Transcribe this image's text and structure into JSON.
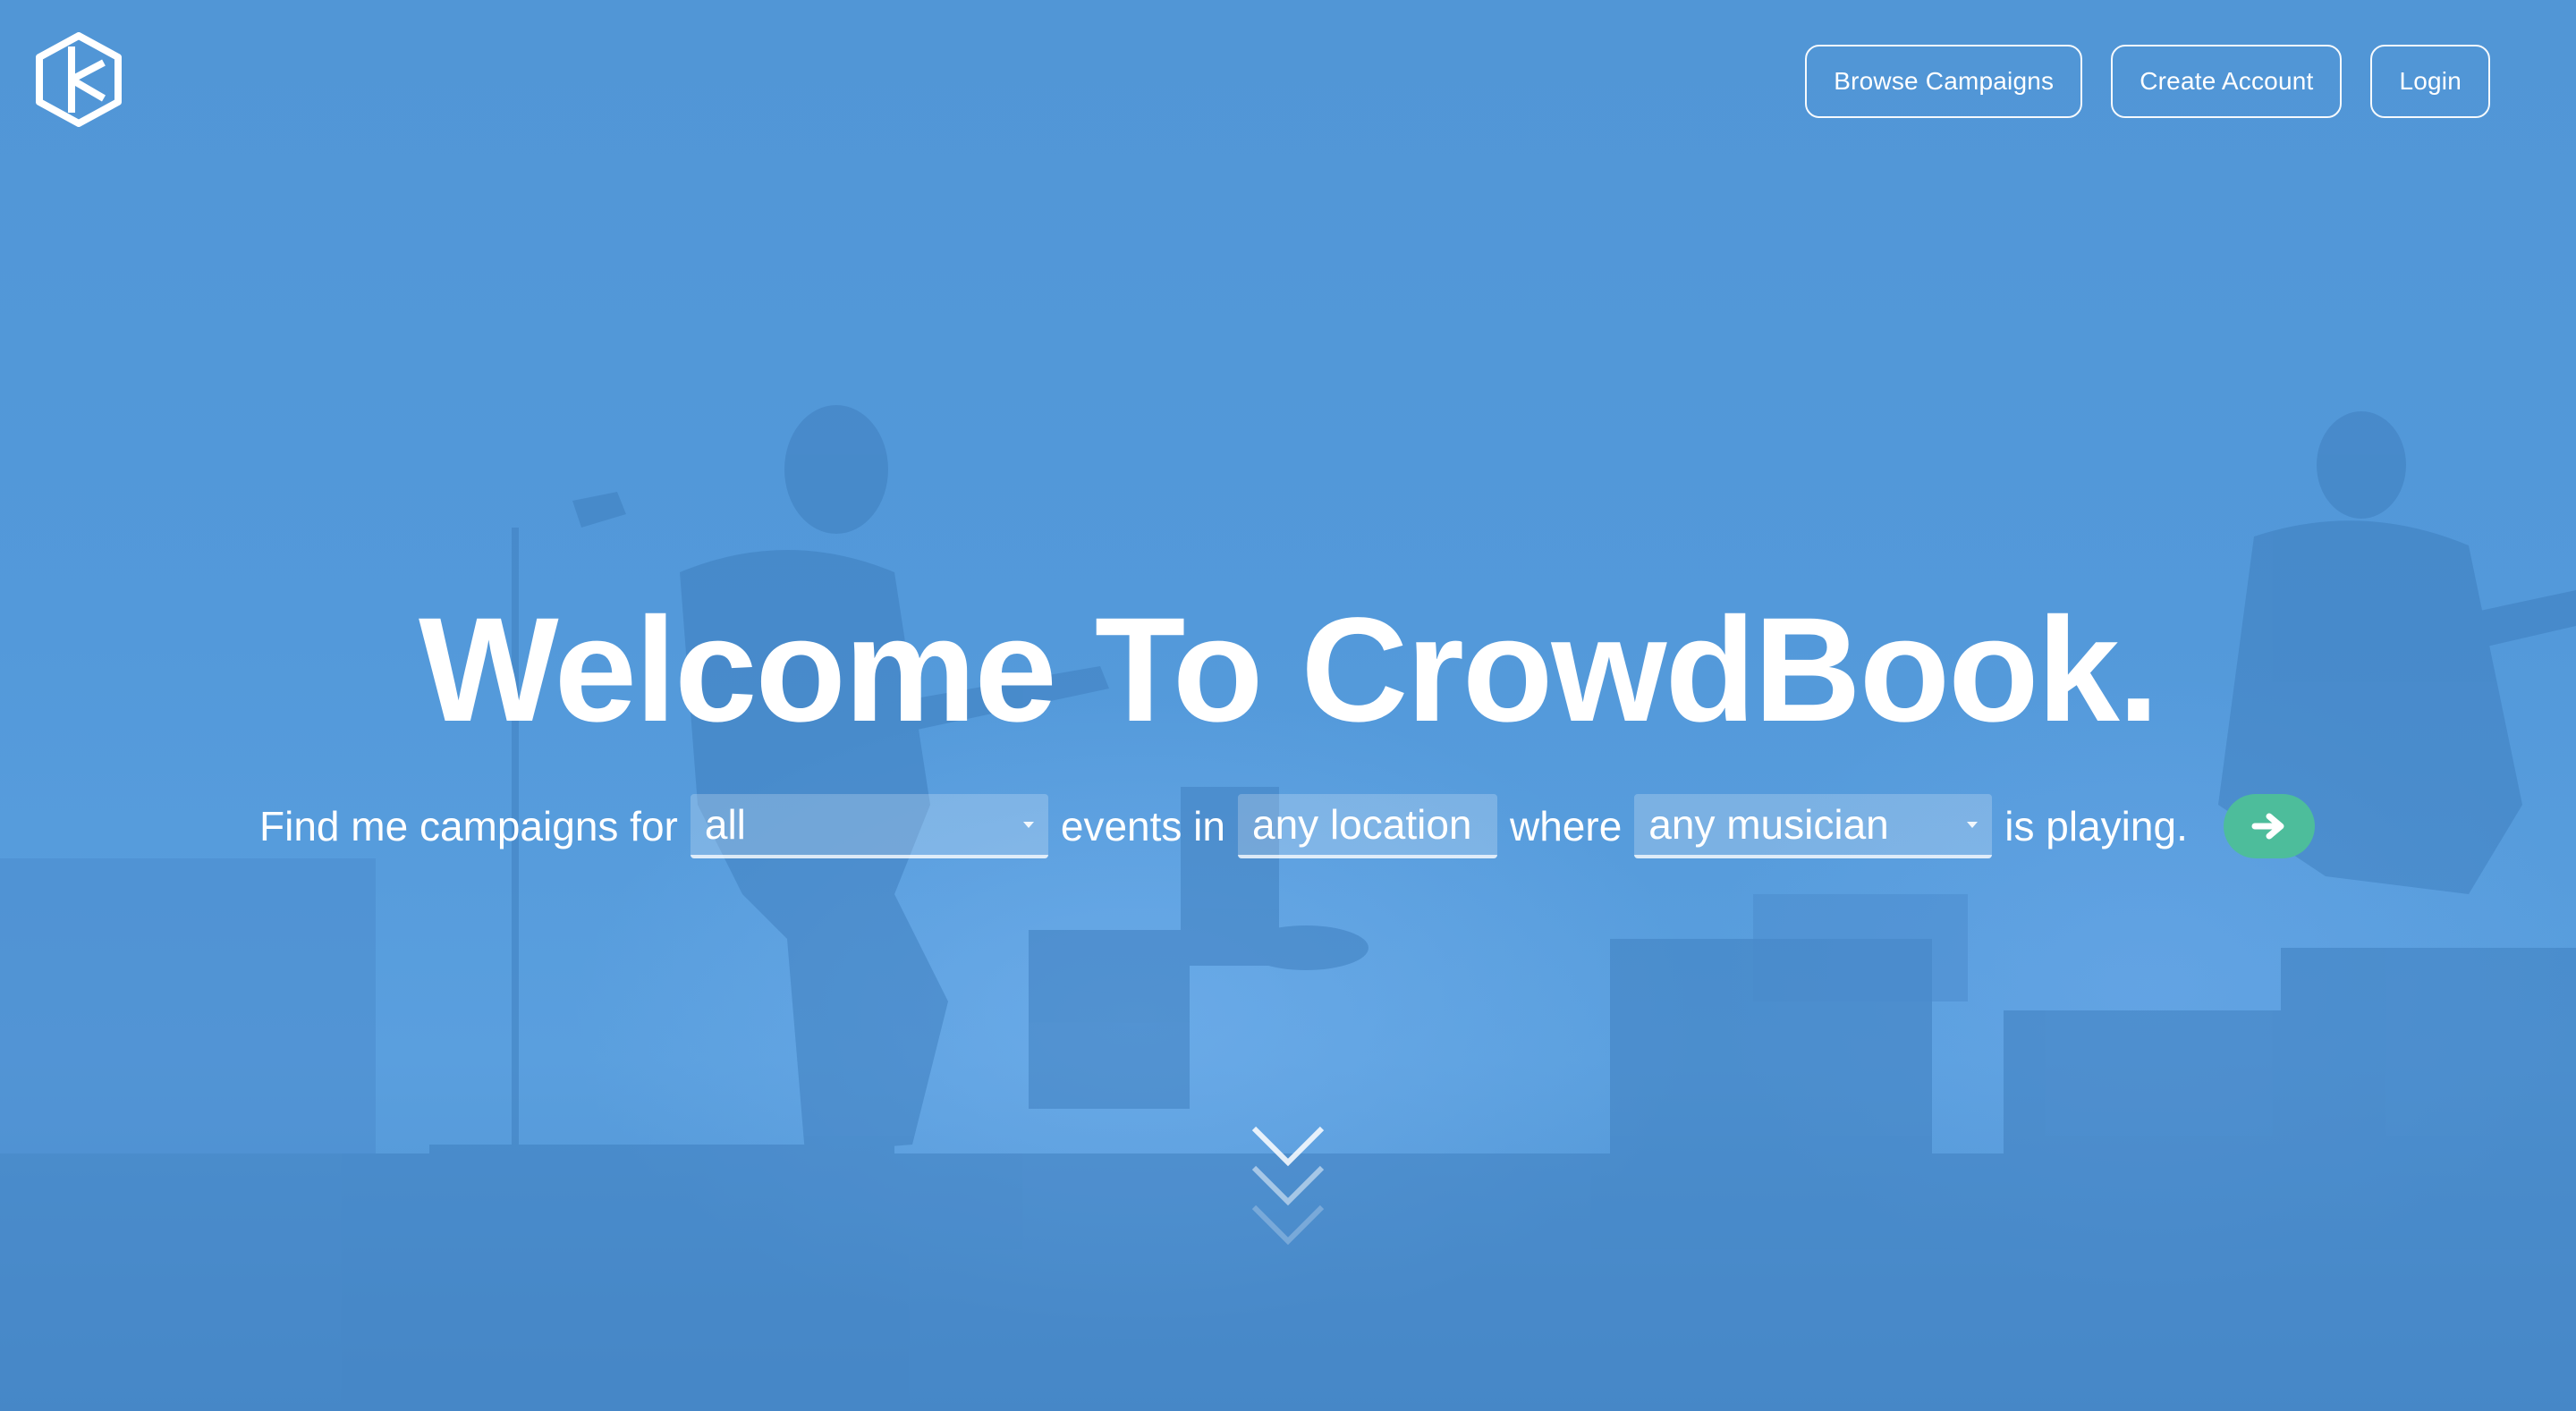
{
  "brand": {
    "logo_icon": "crowdbook-hexagon-logo-icon"
  },
  "nav": {
    "browse_label": "Browse Campaigns",
    "create_label": "Create Account",
    "login_label": "Login"
  },
  "hero": {
    "title": "Welcome To CrowdBook.",
    "sentence": {
      "prefix": "Find me campaigns for",
      "event_type_value": "all",
      "middle1": "events in",
      "location_value": "any location",
      "middle2": "where",
      "musician_value": "any musician",
      "suffix": "is playing.",
      "go_icon": "arrow-right-icon"
    },
    "scroll_icon": "chevrons-down-icon"
  },
  "colors": {
    "background": "#5196d6",
    "accent_green": "#4dbd9b",
    "text": "#ffffff"
  }
}
